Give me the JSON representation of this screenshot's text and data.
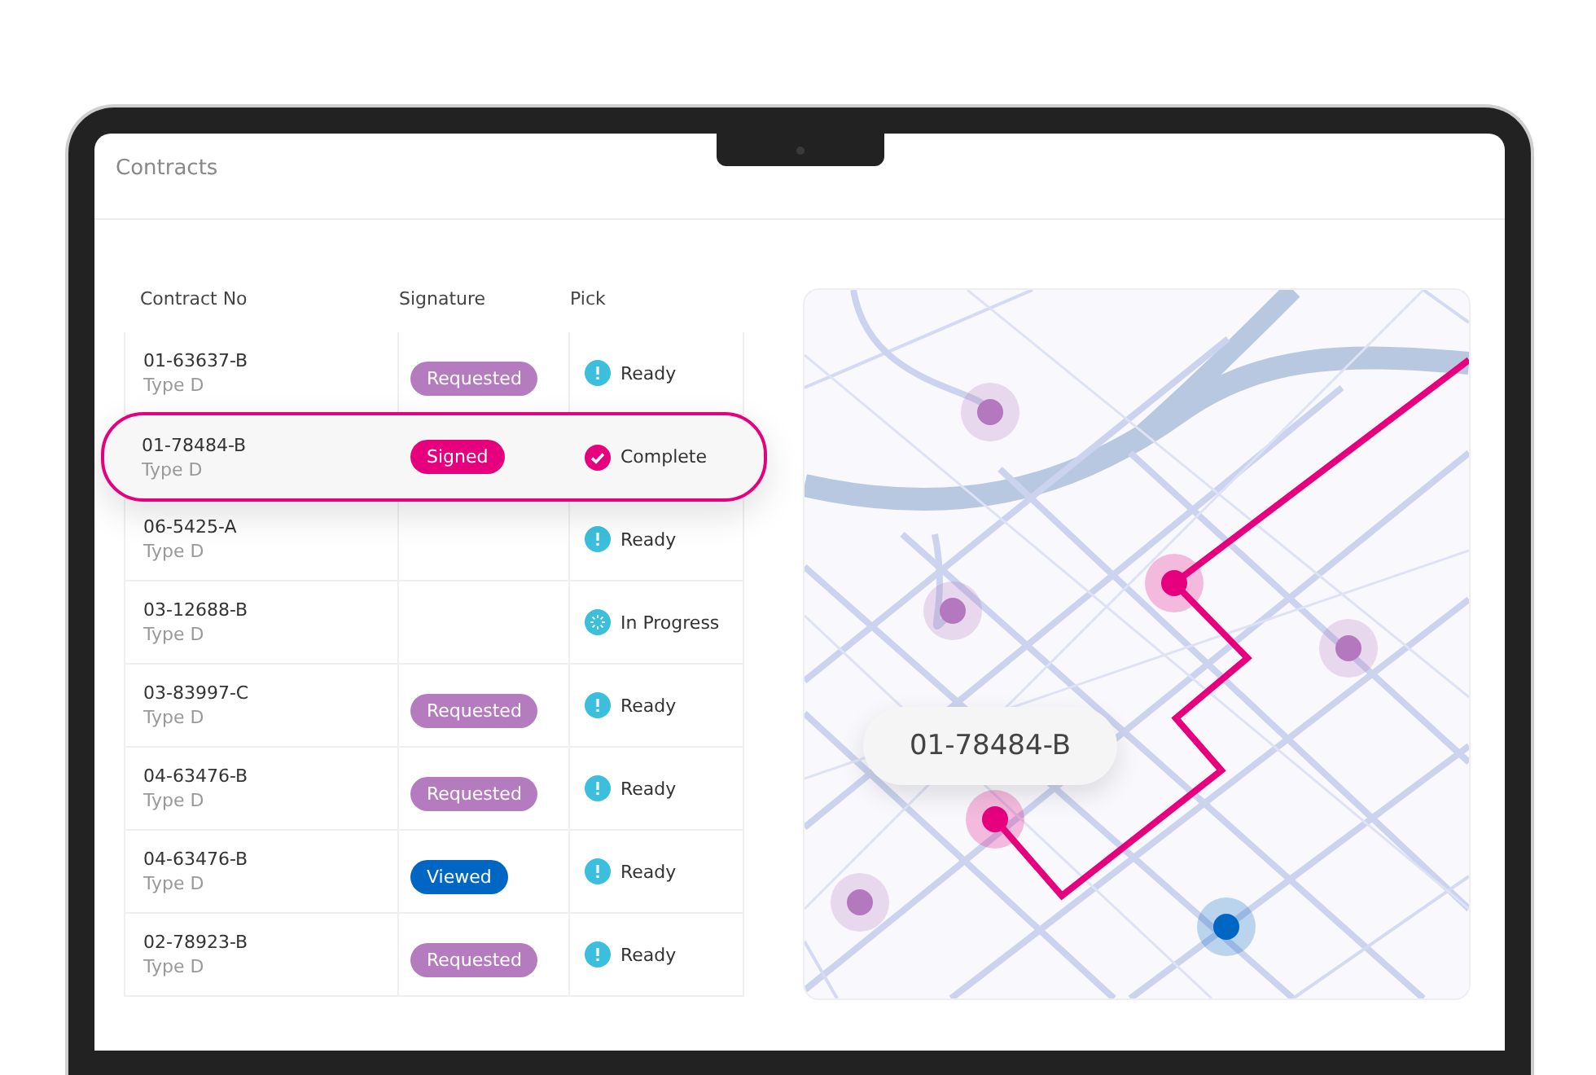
{
  "header": {
    "subtitle": "Contracts"
  },
  "table": {
    "columns": [
      "Contract No",
      "Signature",
      "Pick"
    ],
    "rows": [
      {
        "contract": "01-63637-B",
        "type": "Type D",
        "signature": {
          "kind": "requested",
          "label": "Requested"
        },
        "pick": {
          "kind": "ready",
          "label": "Ready"
        },
        "selected": false
      },
      {
        "contract": "01-78484-B",
        "type": "Type D",
        "signature": {
          "kind": "signed",
          "label": "Signed"
        },
        "pick": {
          "kind": "complete",
          "label": "Complete"
        },
        "selected": true
      },
      {
        "contract": "06-5425-A",
        "type": "Type D",
        "pick": {
          "kind": "ready",
          "label": "Ready"
        },
        "selected": false
      },
      {
        "contract": "03-12688-B",
        "type": "Type D",
        "pick": {
          "kind": "progress",
          "label": "In Progress"
        },
        "selected": false
      },
      {
        "contract": "03-83997-C",
        "type": "Type D",
        "signature": {
          "kind": "requested",
          "label": "Requested"
        },
        "pick": {
          "kind": "ready",
          "label": "Ready"
        },
        "selected": false
      },
      {
        "contract": "04-63476-B",
        "type": "Type D",
        "signature": {
          "kind": "requested",
          "label": "Requested"
        },
        "pick": {
          "kind": "ready",
          "label": "Ready"
        },
        "selected": false
      },
      {
        "contract": "04-63476-B",
        "type": "Type D",
        "signature": {
          "kind": "viewed",
          "label": "Viewed"
        },
        "pick": {
          "kind": "ready",
          "label": "Ready"
        },
        "selected": false
      },
      {
        "contract": "02-78923-B",
        "type": "Type D",
        "signature": {
          "kind": "requested",
          "label": "Requested"
        },
        "pick": {
          "kind": "ready",
          "label": "Ready"
        },
        "selected": false
      }
    ]
  },
  "map": {
    "kind": "picture",
    "label": "01-78484-B"
  }
}
